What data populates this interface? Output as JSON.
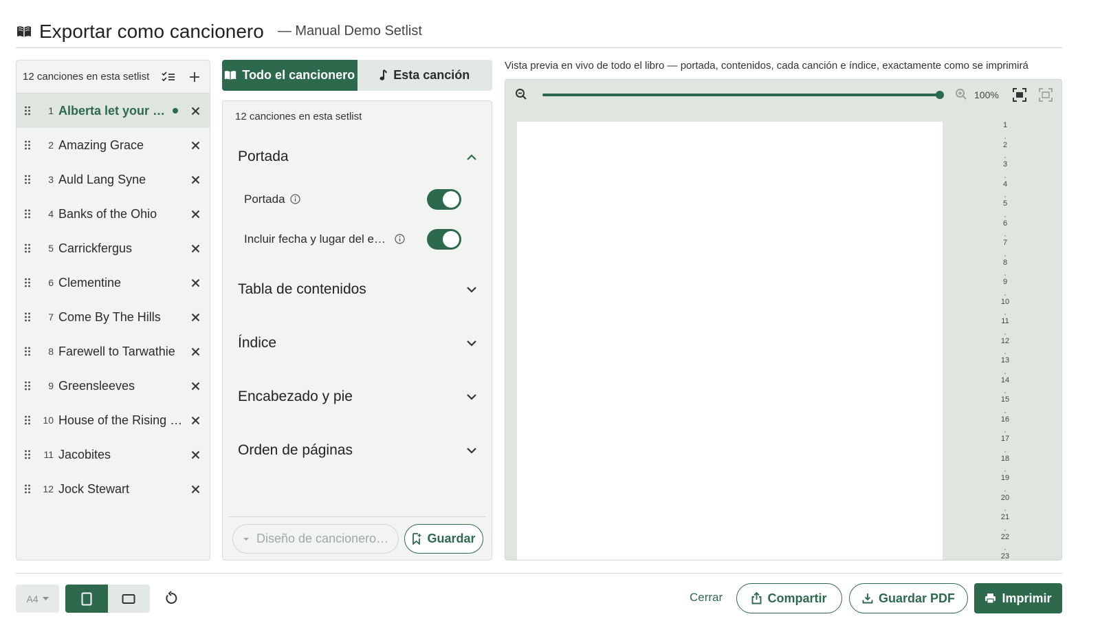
{
  "header": {
    "title": "Exportar como cancionero",
    "subtitle": "— Manual Demo Setlist"
  },
  "songlist": {
    "count_label": "12 canciones en esta setlist",
    "songs": [
      {
        "num": "1",
        "name": "Alberta let your hair hang low"
      },
      {
        "num": "2",
        "name": "Amazing Grace"
      },
      {
        "num": "3",
        "name": "Auld Lang Syne"
      },
      {
        "num": "4",
        "name": "Banks of the Ohio"
      },
      {
        "num": "5",
        "name": "Carrickfergus"
      },
      {
        "num": "6",
        "name": "Clementine"
      },
      {
        "num": "7",
        "name": "Come By The Hills"
      },
      {
        "num": "8",
        "name": "Farewell to Tarwathie"
      },
      {
        "num": "9",
        "name": "Greensleeves"
      },
      {
        "num": "10",
        "name": "House of the Rising Sun"
      },
      {
        "num": "11",
        "name": "Jacobites"
      },
      {
        "num": "12",
        "name": "Jock Stewart"
      }
    ]
  },
  "tabs": {
    "whole": "Todo el cancionero",
    "single": "Esta canción"
  },
  "options": {
    "count_label": "12 canciones en esta setlist",
    "sections": {
      "cover": "Portada",
      "toc": "Tabla de contenidos",
      "index": "Índice",
      "header_footer": "Encabezado y pie",
      "page_order": "Orden de páginas"
    },
    "toggles": {
      "cover": "Portada",
      "date_place": "Incluir fecha y lugar del evento"
    },
    "design_placeholder": "Diseño de cancionero guardado",
    "save_label": "Guardar"
  },
  "preview": {
    "caption": "Vista previa en vivo de todo el libro — portada, contenidos, cada canción e índice, exactamente como se imprimirá",
    "zoom": "100%",
    "zoom_fraction": 1.0,
    "pages": [
      "1",
      "2",
      "3",
      "4",
      "5",
      "6",
      "7",
      "8",
      "9",
      "10",
      "11",
      "12",
      "13",
      "14",
      "15",
      "16",
      "17",
      "18",
      "19",
      "20",
      "21",
      "22",
      "23"
    ]
  },
  "footer": {
    "paper": "A4",
    "close": "Cerrar",
    "share": "Compartir",
    "save_pdf": "Guardar PDF",
    "print": "Imprimir"
  },
  "colors": {
    "accent": "#2d6a4d",
    "panel": "#f1f4f1",
    "preview_bg": "#dfe6e0"
  }
}
